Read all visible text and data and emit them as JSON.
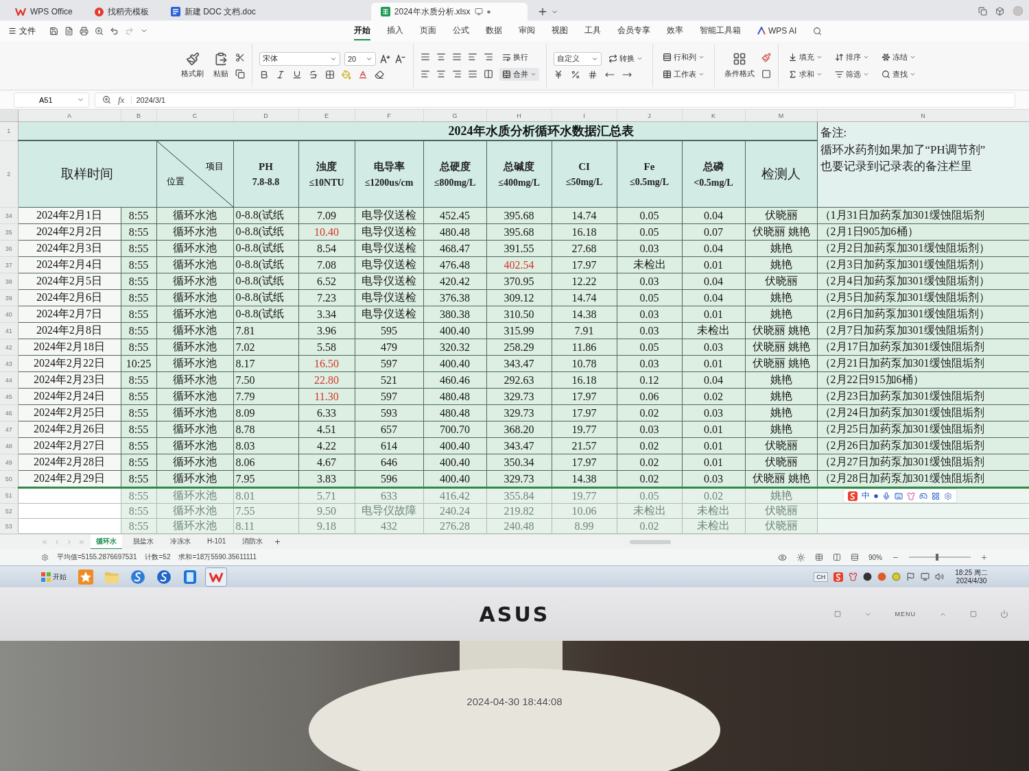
{
  "title_bar": {
    "tabs": [
      {
        "label": "WPS Office",
        "kind": "home",
        "selected": false
      },
      {
        "label": "找稻壳模板",
        "kind": "template",
        "selected": false
      },
      {
        "label": "新建 DOC 文档.doc",
        "kind": "doc",
        "selected": false
      },
      {
        "label": "2024年水质分析.xlsx",
        "kind": "sheet",
        "selected": true
      }
    ]
  },
  "menu_bar": {
    "file": "文件",
    "tabs": [
      {
        "label": "开始",
        "selected": true
      },
      {
        "label": "插入",
        "selected": false
      },
      {
        "label": "页面",
        "selected": false
      },
      {
        "label": "公式",
        "selected": false
      },
      {
        "label": "数据",
        "selected": false
      },
      {
        "label": "审阅",
        "selected": false
      },
      {
        "label": "视图",
        "selected": false
      },
      {
        "label": "工具",
        "selected": false
      },
      {
        "label": "会员专享",
        "selected": false
      },
      {
        "label": "效率",
        "selected": false
      },
      {
        "label": "智能工具箱",
        "selected": false
      }
    ],
    "ai": "WPS AI"
  },
  "ribbon": {
    "format_painter": "格式刷",
    "paste": "粘贴",
    "font_name": "宋体",
    "font_size": "20",
    "wrap": "换行",
    "merge": "合并",
    "number_format": "自定义",
    "convert": "转换",
    "rows_columns": "行和列",
    "worksheet": "工作表",
    "conditional_format": "条件格式",
    "fill": "填充",
    "sort": "排序",
    "freeze": "冻结",
    "sum": "求和",
    "filter": "筛选",
    "find": "查找"
  },
  "formula_bar": {
    "cell": "A51",
    "function_label": "fx",
    "value": "2024/3/1"
  },
  "sheet": {
    "column_letters": [
      "A",
      "B",
      "C",
      "D",
      "E",
      "F",
      "G",
      "H",
      "I",
      "J",
      "K",
      "M",
      "N"
    ],
    "title_row": "1",
    "header_row": "2",
    "title": "2024年水质分析循环水数据汇总表",
    "header": {
      "sample_time": "取样时间",
      "item": "项目",
      "location": "位置",
      "columns": [
        {
          "name": "PH",
          "limit": "7.8-8.8"
        },
        {
          "name": "浊度",
          "limit": "≤10NTU"
        },
        {
          "name": "电导率",
          "limit": "≤1200us/cm"
        },
        {
          "name": "总硬度",
          "limit": "≤800mg/L"
        },
        {
          "name": "总碱度",
          "limit": "≤400mg/L"
        },
        {
          "name": "CI",
          "limit": "≤50mg/L"
        },
        {
          "name": "Fe",
          "limit": "≤0.5mg/L"
        },
        {
          "name": "总磷",
          "limit": "<0.5mg/L"
        }
      ],
      "tester": "检测人",
      "remarks": "备注:\n循环水药剂如果加了“PH调节剂”\n也要记录到记录表的备注栏里"
    },
    "rows": [
      {
        "row": "34",
        "date": "2024年2月1日",
        "time": "8:55",
        "location": "循环水池",
        "ph": "0-8.8(试纸",
        "turbidity": "7.09",
        "conductivity": "电导仪送检",
        "hardness": "452.45",
        "alkalinity": "395.68",
        "chloride": "14.74",
        "iron": "0.05",
        "phosphorus": "0.04",
        "tester": "伏晓丽",
        "remark": "（1月31日加药泵加301缓蚀阻垢剂",
        "turbidity_over": false,
        "alkalinity_over": false,
        "dimmed": false
      },
      {
        "row": "35",
        "date": "2024年2月2日",
        "time": "8:55",
        "location": "循环水池",
        "ph": "0-8.8(试纸",
        "turbidity": "10.40",
        "conductivity": "电导仪送检",
        "hardness": "480.48",
        "alkalinity": "395.68",
        "chloride": "16.18",
        "iron": "0.05",
        "phosphorus": "0.07",
        "tester": "伏晓丽 姚艳",
        "remark": "（2月1日905加6桶）",
        "turbidity_over": true,
        "alkalinity_over": false,
        "dimmed": false
      },
      {
        "row": "36",
        "date": "2024年2月3日",
        "time": "8:55",
        "location": "循环水池",
        "ph": "0-8.8(试纸",
        "turbidity": "8.54",
        "conductivity": "电导仪送检",
        "hardness": "468.47",
        "alkalinity": "391.55",
        "chloride": "27.68",
        "iron": "0.03",
        "phosphorus": "0.04",
        "tester": "姚艳",
        "remark": "（2月2日加药泵加301缓蚀阻垢剂）",
        "turbidity_over": false,
        "alkalinity_over": false,
        "dimmed": false
      },
      {
        "row": "37",
        "date": "2024年2月4日",
        "time": "8:55",
        "location": "循环水池",
        "ph": "0-8.8(试纸",
        "turbidity": "7.08",
        "conductivity": "电导仪送检",
        "hardness": "476.48",
        "alkalinity": "402.54",
        "chloride": "17.97",
        "iron": "未检出",
        "phosphorus": "0.01",
        "tester": "姚艳",
        "remark": "（2月3日加药泵加301缓蚀阻垢剂）",
        "turbidity_over": false,
        "alkalinity_over": true,
        "dimmed": false
      },
      {
        "row": "38",
        "date": "2024年2月5日",
        "time": "8:55",
        "location": "循环水池",
        "ph": "0-8.8(试纸",
        "turbidity": "6.52",
        "conductivity": "电导仪送检",
        "hardness": "420.42",
        "alkalinity": "370.95",
        "chloride": "12.22",
        "iron": "0.03",
        "phosphorus": "0.04",
        "tester": "伏晓丽",
        "remark": "（2月4日加药泵加301缓蚀阻垢剂）",
        "turbidity_over": false,
        "alkalinity_over": false,
        "dimmed": false
      },
      {
        "row": "39",
        "date": "2024年2月6日",
        "time": "8:55",
        "location": "循环水池",
        "ph": "0-8.8(试纸",
        "turbidity": "7.23",
        "conductivity": "电导仪送检",
        "hardness": "376.38",
        "alkalinity": "309.12",
        "chloride": "14.74",
        "iron": "0.05",
        "phosphorus": "0.04",
        "tester": "姚艳",
        "remark": "（2月5日加药泵加301缓蚀阻垢剂）",
        "turbidity_over": false,
        "alkalinity_over": false,
        "dimmed": false
      },
      {
        "row": "40",
        "date": "2024年2月7日",
        "time": "8:55",
        "location": "循环水池",
        "ph": "0-8.8(试纸",
        "turbidity": "3.34",
        "conductivity": "电导仪送检",
        "hardness": "380.38",
        "alkalinity": "310.50",
        "chloride": "14.38",
        "iron": "0.03",
        "phosphorus": "0.01",
        "tester": "姚艳",
        "remark": "（2月6日加药泵加301缓蚀阻垢剂）",
        "turbidity_over": false,
        "alkalinity_over": false,
        "dimmed": false
      },
      {
        "row": "41",
        "date": "2024年2月8日",
        "time": "8:55",
        "location": "循环水池",
        "ph": "7.81",
        "turbidity": "3.96",
        "conductivity": "595",
        "hardness": "400.40",
        "alkalinity": "315.99",
        "chloride": "7.91",
        "iron": "0.03",
        "phosphorus": "未检出",
        "tester": "伏晓丽 姚艳",
        "remark": "（2月7日加药泵加301缓蚀阻垢剂）",
        "turbidity_over": false,
        "alkalinity_over": false,
        "dimmed": false
      },
      {
        "row": "42",
        "date": "2024年2月18日",
        "time": "8:55",
        "location": "循环水池",
        "ph": "7.02",
        "turbidity": "5.58",
        "conductivity": "479",
        "hardness": "320.32",
        "alkalinity": "258.29",
        "chloride": "11.86",
        "iron": "0.05",
        "phosphorus": "0.03",
        "tester": "伏晓丽 姚艳",
        "remark": "（2月17日加药泵加301缓蚀阻垢剂",
        "turbidity_over": false,
        "alkalinity_over": false,
        "dimmed": false
      },
      {
        "row": "43",
        "date": "2024年2月22日",
        "time": "10:25",
        "location": "循环水池",
        "ph": "8.17",
        "turbidity": "16.50",
        "conductivity": "597",
        "hardness": "400.40",
        "alkalinity": "343.47",
        "chloride": "10.78",
        "iron": "0.03",
        "phosphorus": "0.01",
        "tester": "伏晓丽 姚艳",
        "remark": "（2月21日加药泵加301缓蚀阻垢剂",
        "turbidity_over": true,
        "alkalinity_over": false,
        "dimmed": false
      },
      {
        "row": "44",
        "date": "2024年2月23日",
        "time": "8:55",
        "location": "循环水池",
        "ph": "7.50",
        "turbidity": "22.80",
        "conductivity": "521",
        "hardness": "460.46",
        "alkalinity": "292.63",
        "chloride": "16.18",
        "iron": "0.12",
        "phosphorus": "0.04",
        "tester": "姚艳",
        "remark": "（2月22日915加6桶）",
        "turbidity_over": true,
        "alkalinity_over": false,
        "dimmed": false
      },
      {
        "row": "45",
        "date": "2024年2月24日",
        "time": "8:55",
        "location": "循环水池",
        "ph": "7.79",
        "turbidity": "11.30",
        "conductivity": "597",
        "hardness": "480.48",
        "alkalinity": "329.73",
        "chloride": "17.97",
        "iron": "0.06",
        "phosphorus": "0.02",
        "tester": "姚艳",
        "remark": "（2月23日加药泵加301缓蚀阻垢剂",
        "turbidity_over": true,
        "alkalinity_over": false,
        "dimmed": false
      },
      {
        "row": "46",
        "date": "2024年2月25日",
        "time": "8:55",
        "location": "循环水池",
        "ph": "8.09",
        "turbidity": "6.33",
        "conductivity": "593",
        "hardness": "480.48",
        "alkalinity": "329.73",
        "chloride": "17.97",
        "iron": "0.02",
        "phosphorus": "0.03",
        "tester": "姚艳",
        "remark": "（2月24日加药泵加301缓蚀阻垢剂",
        "turbidity_over": false,
        "alkalinity_over": false,
        "dimmed": false
      },
      {
        "row": "47",
        "date": "2024年2月26日",
        "time": "8:55",
        "location": "循环水池",
        "ph": "8.78",
        "turbidity": "4.51",
        "conductivity": "657",
        "hardness": "700.70",
        "alkalinity": "368.20",
        "chloride": "19.77",
        "iron": "0.03",
        "phosphorus": "0.01",
        "tester": "姚艳",
        "remark": "（2月25日加药泵加301缓蚀阻垢剂",
        "turbidity_over": false,
        "alkalinity_over": false,
        "dimmed": false
      },
      {
        "row": "48",
        "date": "2024年2月27日",
        "time": "8:55",
        "location": "循环水池",
        "ph": "8.03",
        "turbidity": "4.22",
        "conductivity": "614",
        "hardness": "400.40",
        "alkalinity": "343.47",
        "chloride": "21.57",
        "iron": "0.02",
        "phosphorus": "0.01",
        "tester": "伏晓丽",
        "remark": "（2月26日加药泵加301缓蚀阻垢剂",
        "turbidity_over": false,
        "alkalinity_over": false,
        "dimmed": false
      },
      {
        "row": "49",
        "date": "2024年2月28日",
        "time": "8:55",
        "location": "循环水池",
        "ph": "8.06",
        "turbidity": "4.67",
        "conductivity": "646",
        "hardness": "400.40",
        "alkalinity": "350.34",
        "chloride": "17.97",
        "iron": "0.02",
        "phosphorus": "0.01",
        "tester": "伏晓丽",
        "remark": "（2月27日加药泵加301缓蚀阻垢剂",
        "turbidity_over": false,
        "alkalinity_over": false,
        "dimmed": false
      },
      {
        "row": "50",
        "date": "2024年2月29日",
        "time": "8:55",
        "location": "循环水池",
        "ph": "7.95",
        "turbidity": "3.83",
        "conductivity": "596",
        "hardness": "400.40",
        "alkalinity": "329.73",
        "chloride": "14.38",
        "iron": "0.02",
        "phosphorus": "0.03",
        "tester": "伏晓丽 姚艳",
        "remark": "（2月28日加药泵加301缓蚀阻垢剂",
        "turbidity_over": false,
        "alkalinity_over": false,
        "dimmed": false
      },
      {
        "row": "51",
        "time": "8:55",
        "location": "循环水池",
        "ph": "8.01",
        "turbidity": "5.71",
        "conductivity": "633",
        "hardness": "416.42",
        "alkalinity": "355.84",
        "chloride": "19.77",
        "iron": "0.05",
        "phosphorus": "0.02",
        "tester": "姚艳",
        "turbidity_over": false,
        "alkalinity_over": false,
        "dimmed": true
      },
      {
        "row": "52",
        "time": "8:55",
        "location": "循环水池",
        "ph": "7.55",
        "turbidity": "9.50",
        "conductivity": "电导仪故障",
        "hardness": "240.24",
        "alkalinity": "219.82",
        "chloride": "10.06",
        "iron": "未检出",
        "phosphorus": "未检出",
        "tester": "伏晓丽",
        "turbidity_over": false,
        "alkalinity_over": false,
        "dimmed": true
      },
      {
        "row": "53",
        "time": "8:55",
        "location": "循环水池",
        "ph": "8.11",
        "turbidity": "9.18",
        "conductivity": "432",
        "hardness": "276.28",
        "alkalinity": "240.48",
        "chloride": "8.99",
        "iron": "0.02",
        "phosphorus": "未检出",
        "tester": "伏晓丽",
        "turbidity_over": false,
        "alkalinity_over": false,
        "dimmed": true
      }
    ]
  },
  "ime_toolbar": {
    "mode": "中"
  },
  "sheet_tabs": [
    {
      "label": "循环水",
      "selected": true
    },
    {
      "label": "脱盐水",
      "selected": false
    },
    {
      "label": "冷冻水",
      "selected": false
    },
    {
      "label": "H-101",
      "selected": false
    },
    {
      "label": "消防水",
      "selected": false
    }
  ],
  "status_bar": {
    "average": "平均值=5155.2876697531",
    "count": "计数=52",
    "sum": "求和=18万5590.35611111",
    "zoom": "90%",
    "zoom_slider": {
      "level": 0.45
    }
  },
  "taskbar": {
    "start": "开始",
    "language": "CH",
    "time": "18:25 周二",
    "date": "2024/4/30"
  },
  "monitor": {
    "brand": "ASUS",
    "menu_label": "MENU"
  },
  "photo_timestamp": "2024-04-30 18:44:08"
}
